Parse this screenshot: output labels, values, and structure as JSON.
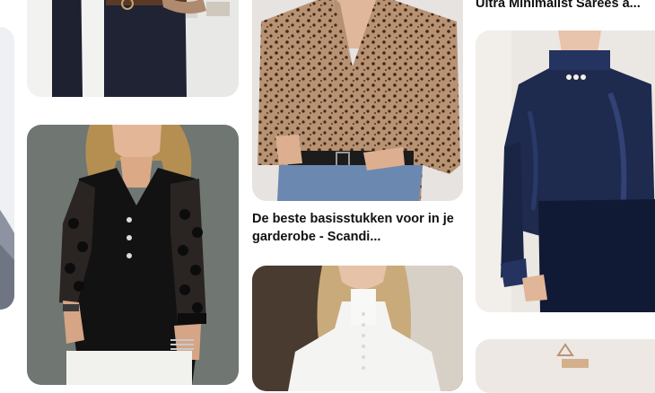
{
  "feed": {
    "pins": [
      {
        "title": ""
      },
      {
        "title": ""
      },
      {
        "title": ""
      },
      {
        "title": "De beste basisstukken voor in je garderobe - Scandi..."
      },
      {
        "title": ""
      },
      {
        "title": "Ultra Minimalist Sarees a..."
      },
      {
        "title": ""
      },
      {
        "title": ""
      }
    ]
  }
}
